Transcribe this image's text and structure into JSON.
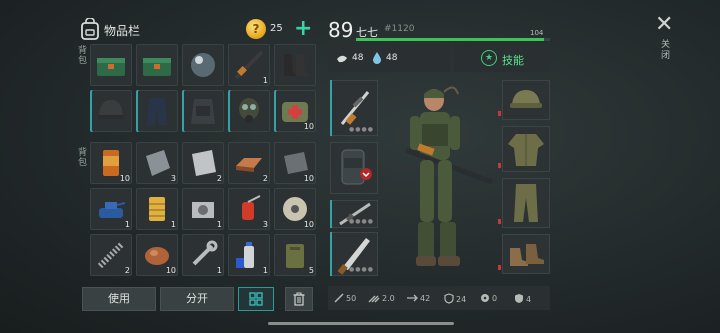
{
  "inventory": {
    "title": "物品栏",
    "coins": "25",
    "side_label_top": "背包",
    "side_label_mid": "背包",
    "rows_top": [
      [
        {
          "icon": "green-toolbox-icon",
          "qty": ""
        },
        {
          "icon": "green-toolbox-icon",
          "qty": ""
        },
        {
          "icon": "glass-sphere-icon",
          "qty": ""
        },
        {
          "icon": "assault-rifle-icon",
          "qty": "1"
        },
        {
          "icon": "combat-boots-icon",
          "qty": ""
        }
      ],
      [
        {
          "icon": "helmet-icon",
          "qty": ""
        },
        {
          "icon": "tactical-pants-icon",
          "qty": ""
        },
        {
          "icon": "body-armor-icon",
          "qty": ""
        },
        {
          "icon": "gas-mask-icon",
          "qty": ""
        },
        {
          "icon": "medkit-bag-icon",
          "qty": "10"
        }
      ]
    ],
    "rows_bottom": [
      [
        {
          "icon": "tin-can-icon",
          "qty": "10"
        },
        {
          "icon": "steel-plate-icon",
          "qty": "3"
        },
        {
          "icon": "aluminum-plate-icon",
          "qty": "2"
        },
        {
          "icon": "copper-ingot-icon",
          "qty": "2"
        },
        {
          "icon": "iron-ingot-icon",
          "qty": "10"
        }
      ],
      [
        {
          "icon": "toy-tank-icon",
          "qty": "1"
        },
        {
          "icon": "filter-icon",
          "qty": "1"
        },
        {
          "icon": "engine-part-icon",
          "qty": "1"
        },
        {
          "icon": "red-blowtorch-icon",
          "qty": "3"
        },
        {
          "icon": "wire-spool-icon",
          "qty": "10"
        }
      ],
      [
        {
          "icon": "spring-icon",
          "qty": "2"
        },
        {
          "icon": "meat-chunk-icon",
          "qty": "10"
        },
        {
          "icon": "wrench-icon",
          "qty": "1"
        },
        {
          "icon": "spray-can-icon",
          "qty": "1"
        },
        {
          "icon": "jerrycan-icon",
          "qty": "5"
        }
      ]
    ],
    "use_button": "使用",
    "split_button": "分开"
  },
  "player": {
    "level": "89",
    "name": "七七",
    "id": "#1120",
    "hp": "104",
    "hp_fraction": 0.97,
    "food": "48",
    "water": "48",
    "skill_label": "技能"
  },
  "stats": {
    "attack": "50",
    "speed": "2.0",
    "range": "42",
    "defense": "24",
    "radiation": "0",
    "armor": "4"
  },
  "close_label": "关闭"
}
